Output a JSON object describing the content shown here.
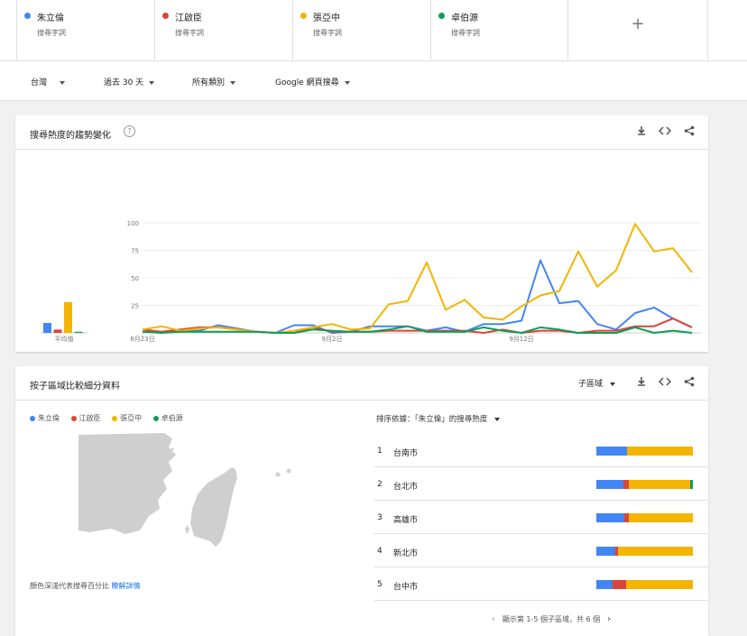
{
  "terms": [
    {
      "name": "朱立倫",
      "sub": "搜尋字詞",
      "color": "#4285f4"
    },
    {
      "name": "江啟臣",
      "sub": "搜尋字詞",
      "color": "#db4437"
    },
    {
      "name": "張亞中",
      "sub": "搜尋字詞",
      "color": "#f4b400"
    },
    {
      "name": "卓伯源",
      "sub": "搜尋字詞",
      "color": "#0f9d58"
    }
  ],
  "add_term": "+",
  "filters": {
    "region": "台灣",
    "period": "過去 30 天",
    "category": "所有類別",
    "search_type": "Google 網頁搜尋"
  },
  "trend_card": {
    "title": "搜尋熱度的趨勢變化",
    "help": "?",
    "avg_label": "平均值"
  },
  "chart_data": {
    "type": "line",
    "x_ticks": [
      "8月23日",
      "9月2日",
      "9月12日"
    ],
    "y_ticks": [
      25,
      50,
      75,
      100
    ],
    "ylim": [
      0,
      100
    ],
    "averages": [
      9,
      3,
      28,
      1
    ],
    "series": [
      {
        "name": "朱立倫",
        "color": "#4285f4",
        "values": [
          3,
          0,
          2,
          2,
          7,
          4,
          1,
          0,
          7,
          7,
          0,
          1,
          6,
          6,
          6,
          2,
          5,
          1,
          8,
          8,
          11,
          66,
          27,
          29,
          8,
          3,
          18,
          23,
          13,
          5
        ]
      },
      {
        "name": "江啟臣",
        "color": "#db4437",
        "values": [
          3,
          1,
          3,
          5,
          5,
          3,
          1,
          0,
          0,
          5,
          1,
          1,
          1,
          2,
          2,
          2,
          2,
          2,
          0,
          3,
          0,
          2,
          2,
          0,
          2,
          2,
          6,
          6,
          13,
          5
        ]
      },
      {
        "name": "張亞中",
        "color": "#f4b400",
        "values": [
          3,
          6,
          2,
          4,
          5,
          3,
          1,
          0,
          2,
          5,
          8,
          3,
          4,
          26,
          29,
          64,
          21,
          30,
          14,
          12,
          24,
          34,
          38,
          74,
          42,
          57,
          99,
          74,
          77,
          55
        ]
      },
      {
        "name": "卓伯源",
        "color": "#0f9d58",
        "values": [
          1,
          0,
          1,
          1,
          1,
          1,
          1,
          0,
          0,
          3,
          2,
          1,
          1,
          3,
          6,
          1,
          1,
          1,
          5,
          2,
          0,
          5,
          3,
          0,
          0,
          0,
          5,
          0,
          2,
          0
        ]
      }
    ]
  },
  "region_card": {
    "title": "按子區域比較細分資料",
    "subregion_label": "子區域",
    "sort_label": "排序依據：「朱立倫」的搜尋熱度",
    "map_note": "顏色深淺代表搜尋百分比",
    "map_link": "瞭解詳情",
    "pager": "顯示第 1-5 個子區域，共 6 個",
    "rows": [
      {
        "rank": "1",
        "city": "台南市",
        "shares": [
          32,
          0,
          68,
          0
        ]
      },
      {
        "rank": "2",
        "city": "台北市",
        "shares": [
          28,
          6,
          63,
          3
        ]
      },
      {
        "rank": "3",
        "city": "高雄市",
        "shares": [
          29,
          5,
          66,
          0
        ]
      },
      {
        "rank": "4",
        "city": "新北市",
        "shares": [
          20,
          2,
          78,
          0
        ]
      },
      {
        "rank": "5",
        "city": "台中市",
        "shares": [
          17,
          14,
          69,
          0
        ]
      }
    ]
  }
}
